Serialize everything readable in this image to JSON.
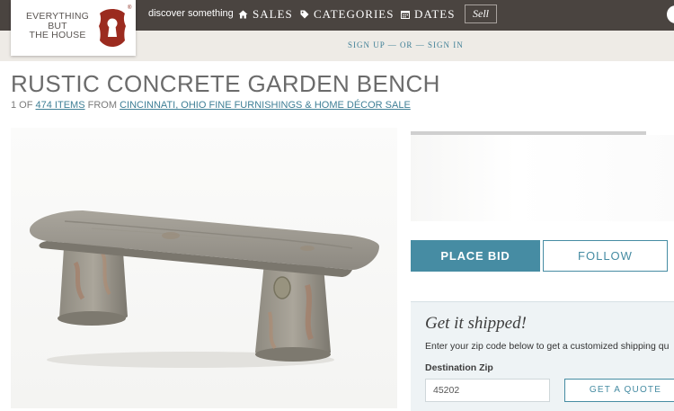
{
  "logo": {
    "line1": "EVERYTHING",
    "line2": "BUT",
    "line3": "THE HOUSE",
    "reg": "®"
  },
  "nav": {
    "discover": "discover something",
    "sales": "SALES",
    "categories": "CATEGORIES",
    "dates": "DATES",
    "sell": "Sell"
  },
  "auth": {
    "sign_up": "SIGN UP",
    "separator": "— OR —",
    "sign_in": "SIGN IN"
  },
  "item": {
    "title": "RUSTIC CONCRETE GARDEN BENCH",
    "position": "1 OF",
    "count_link": "474 ITEMS",
    "from": "FROM",
    "sale_link": "CINCINNATI, OHIO FINE FURNISHINGS & HOME DÉCOR SALE"
  },
  "actions": {
    "place_bid": "PLACE BID",
    "follow": "FOLLOW"
  },
  "shipping": {
    "title": "Get it shipped!",
    "description": "Enter your zip code below to get a customized shipping qu",
    "zip_label": "Destination Zip",
    "zip_value": "45202",
    "quote_button": "GET A QUOTE"
  },
  "colors": {
    "header_bg": "#4a4440",
    "subbar_bg": "#eeebe6",
    "accent": "#468ca3",
    "logo_red": "#9b2b1f"
  },
  "icons": {
    "sales": "home-icon",
    "categories": "tag-icon",
    "dates": "calendar-icon",
    "logo": "keyhole-logo-icon",
    "user": "user-avatar-icon"
  }
}
